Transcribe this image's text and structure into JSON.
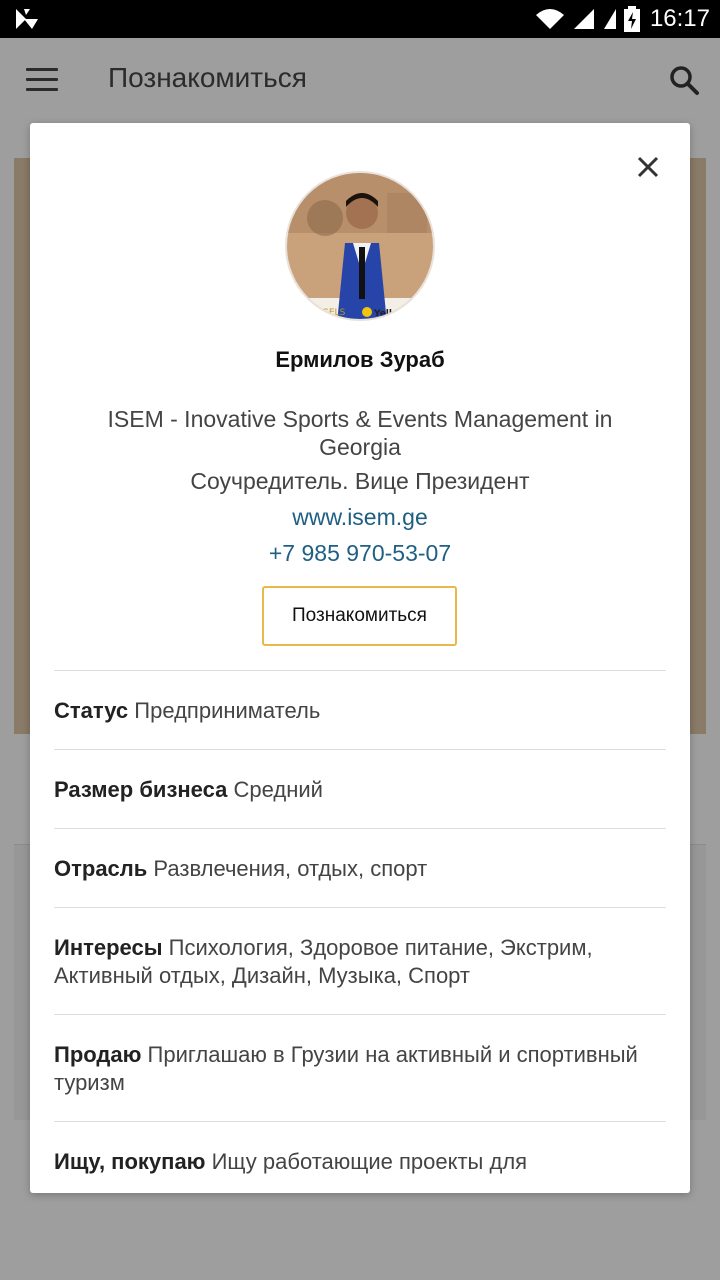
{
  "status_bar": {
    "time": "16:17",
    "icons": [
      "app-notification-icon",
      "wifi-icon",
      "signal-icon",
      "signal-icon",
      "battery-charging-icon"
    ]
  },
  "appbar": {
    "title": "Познакомиться",
    "icons": [
      "menu-icon",
      "search-icon"
    ]
  },
  "profile": {
    "name": "Ермилов Зураб",
    "company": "ISEM - Inovative Sports & Events Management in Georgia",
    "position": "Соучредитель. Вице Президент",
    "website": "www.isem.ge",
    "phone": "+7 985 970-53-07",
    "connect_label": "Познакомиться",
    "avatar_text_left": "ANGELS",
    "avatar_text_right": "Yellow"
  },
  "details": [
    {
      "label": "Статус",
      "value": "Предприниматель"
    },
    {
      "label": "Размер бизнеса",
      "value": "Средний"
    },
    {
      "label": "Отрасль",
      "value": "Развлечения, отдых, спорт"
    },
    {
      "label": "Интересы",
      "value": "Психология, Здоровое питание, Экстрим, Активный отдых, Дизайн, Музыка, Спорт"
    },
    {
      "label": "Продаю",
      "value": "Приглашаю в Грузии на активный и спортивный туризм"
    },
    {
      "label": "Ищу, покупаю",
      "value": "Ищу работающие проекты для"
    }
  ],
  "colors": {
    "accent_border": "#e9b84a",
    "link": "#1e5f82",
    "overlay": "#9e9e9e"
  }
}
